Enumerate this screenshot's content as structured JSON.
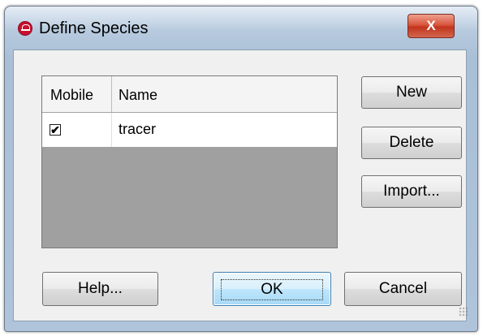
{
  "window": {
    "title": "Define Species",
    "close_label": "X"
  },
  "table": {
    "columns": [
      "Mobile",
      "Name"
    ],
    "rows": [
      {
        "mobile_checked": true,
        "mobile_mark": "✔",
        "name": "tracer"
      }
    ]
  },
  "side_buttons": {
    "new_label": "New",
    "delete_label": "Delete",
    "import_label": "Import..."
  },
  "footer_buttons": {
    "help_label": "Help...",
    "ok_label": "OK",
    "cancel_label": "Cancel"
  },
  "colors": {
    "title_bar": "#b7cade",
    "close_button": "#c2351e",
    "app_icon": "#c8102e",
    "list_empty_area": "#a0a0a0",
    "ok_focus_border": "#3c7fb1"
  },
  "icons": {
    "app": "app-logo-icon",
    "close": "close-icon",
    "grip": "resize-grip-icon"
  }
}
